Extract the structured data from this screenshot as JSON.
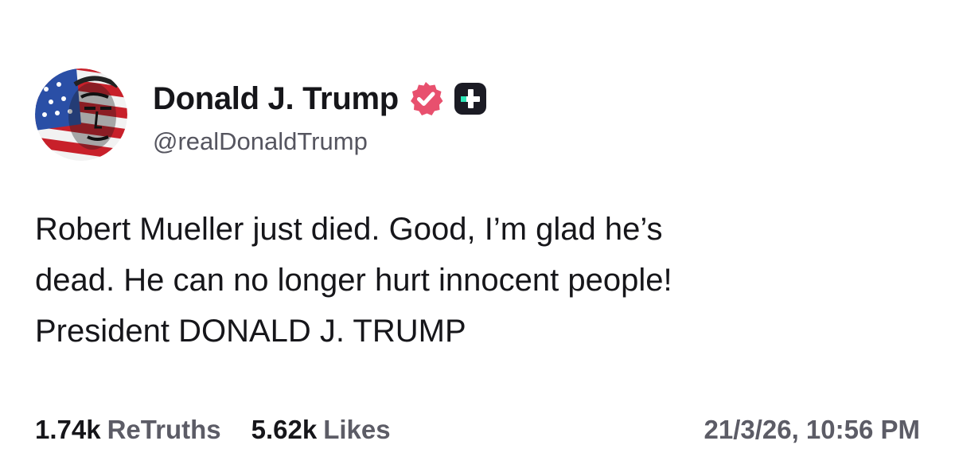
{
  "author": {
    "display_name": "Donald J. Trump",
    "handle": "@realDonaldTrump",
    "verified_color": "#e8506e",
    "plus_badge_color": "#1b1b24",
    "plus_badge_accent": "#2ee6b8"
  },
  "post": {
    "lines": [
      "Robert Mueller just died. Good, I’m glad he’s",
      "dead. He can no longer hurt innocent people!",
      "President DONALD J. TRUMP"
    ]
  },
  "stats": {
    "retruths_count": "1.74k",
    "retruths_label": "ReTruths",
    "likes_count": "5.62k",
    "likes_label": "Likes"
  },
  "timestamp": "21/3/26, 10:56 PM"
}
